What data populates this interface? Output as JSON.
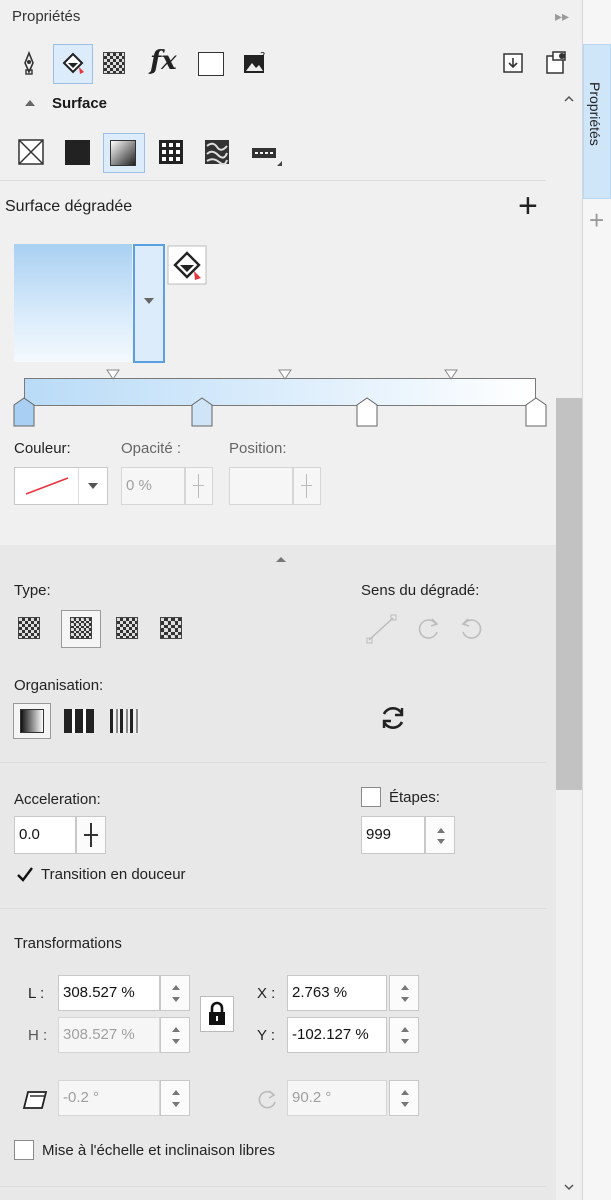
{
  "header": {
    "title": "Propriétés",
    "collapse_glyph": "▸▸",
    "close_glyph": "✕"
  },
  "sidebar": {
    "tab_label": "Propriétés",
    "add_glyph": "+"
  },
  "toolbar": {
    "icons": [
      "pen-outline-icon",
      "fill-bucket-icon",
      "transparency-icon",
      "effects-fx-icon",
      "frame-icon",
      "image-help-icon"
    ],
    "right_icons": [
      "panel-toggle-icon",
      "options-icon"
    ]
  },
  "surface": {
    "section_title": "Surface",
    "fill_types": [
      "no-fill-icon",
      "uniform-fill-icon",
      "gradient-fill-icon",
      "pattern-fill-icon",
      "texture-fill-icon",
      "postscript-fill-icon"
    ],
    "gradient_title": "Surface dégradée",
    "add_glyph": "+"
  },
  "node_controls": {
    "color_label": "Couleur:",
    "opacity_label": "Opacité :",
    "opacity_value": "0 %",
    "position_label": "Position:",
    "position_value": ""
  },
  "type": {
    "label": "Type:",
    "direction_label": "Sens du dégradé:"
  },
  "organisation": {
    "label": "Organisation:"
  },
  "acceleration": {
    "label": "Acceleration:",
    "value": "0.0",
    "steps_label": "Étapes:",
    "steps_value": "999",
    "smooth_label": "Transition en douceur"
  },
  "transformations": {
    "label": "Transformations",
    "l_label": "L :",
    "l_value": "308.527 %",
    "h_label": "H :",
    "h_value": "308.527 %",
    "x_label": "X :",
    "x_value": "2.763 %",
    "y_label": "Y :",
    "y_value": "-102.127 %",
    "skew_value": "-0.2 °",
    "rotate_value": "90.2 °",
    "free_scale_label": "Mise à l'échelle et inclinaison libres"
  },
  "colors": {
    "accent": "#cfe5f8",
    "gradient_start": "#a9d0f2",
    "gradient_end": "#ffffff",
    "swatch_line": "#e8343c"
  }
}
